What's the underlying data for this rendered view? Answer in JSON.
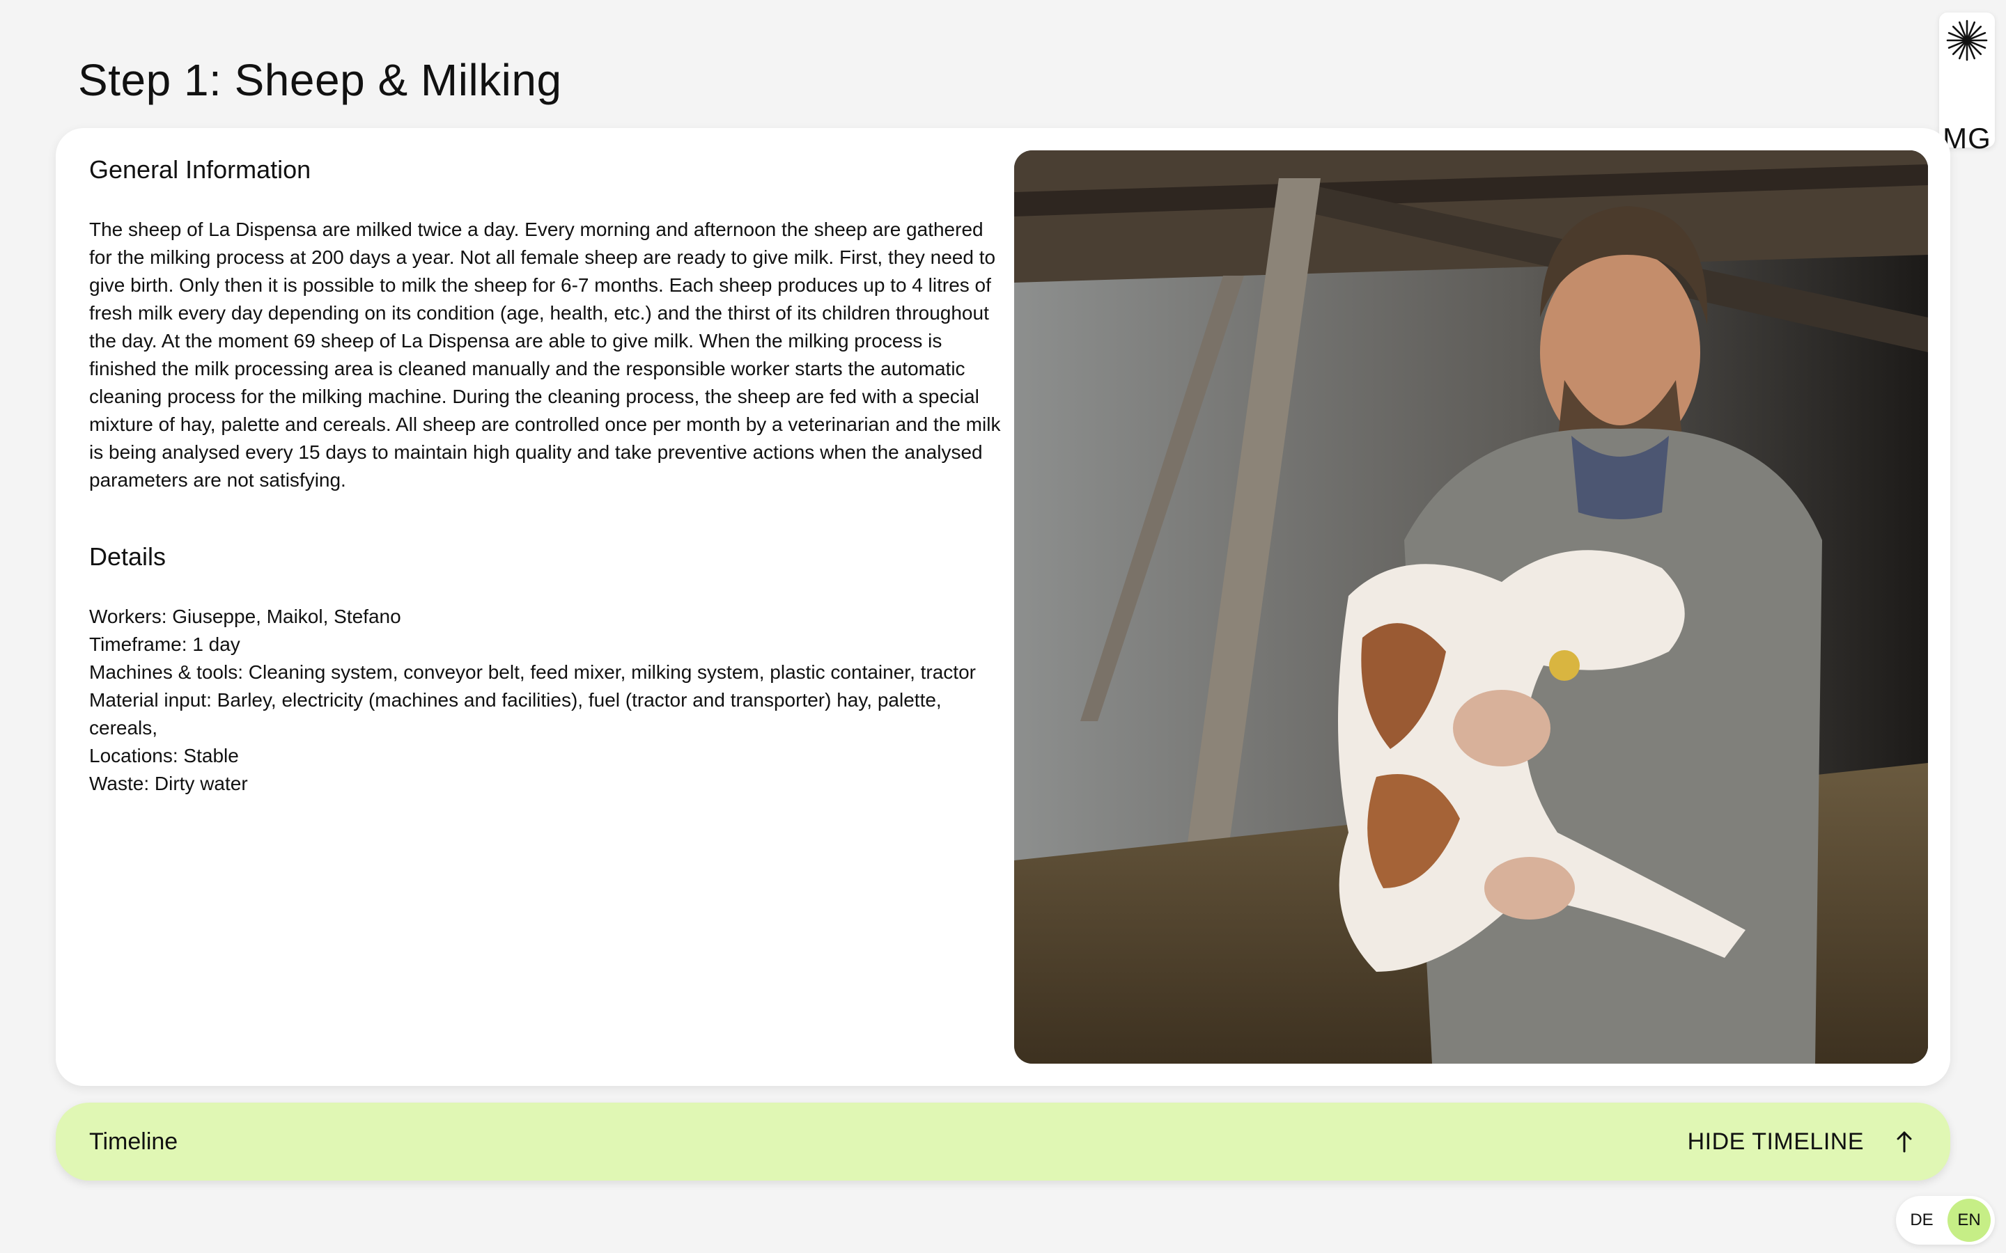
{
  "page": {
    "title": "Step 1: Sheep & Milking"
  },
  "side_tab": {
    "logo_icon": "starburst-logo-icon",
    "initials": "MG"
  },
  "general": {
    "heading": "General Information",
    "body": "The sheep of La Dispensa are milked twice a day. Every morning and afternoon the sheep are gathered for the milking process at 200 days a year. Not all female sheep are ready to give milk. First, they need to give birth. Only then it is possible to milk the sheep for 6-7 months. Each sheep produces up to 4 litres of fresh milk every day depending on its condition (age, health, etc.) and the thirst of its children throughout the day. At the moment 69 sheep of La Dispensa are able to give milk. When the milking process is finished the milk processing area is cleaned manually and the responsible worker starts the automatic cleaning process for the milking machine. During the cleaning process, the sheep are fed with a special mixture of hay, palette and cereals. All sheep are controlled once per month by a veterinarian and the milk is being analysed every 15 days to maintain high quality and take preventive actions when the analysed parameters are not satisfying."
  },
  "details": {
    "heading": "Details",
    "workers": "Workers: Giuseppe, Maikol, Stefano",
    "timeframe": "Timeframe: 1 day",
    "machines": "Machines & tools: Cleaning system, conveyor belt, feed mixer, milking system, plastic container, tractor",
    "material": "Material input: Barley, electricity (machines and facilities), fuel (tractor and transporter) hay, palette, cereals,",
    "locations": "Locations: Stable",
    "waste": "Waste: Dirty water"
  },
  "timeline": {
    "label": "Timeline",
    "toggle_label": "HIDE TIMELINE",
    "toggle_icon": "arrow-up-icon"
  },
  "language": {
    "options": [
      "DE",
      "EN"
    ],
    "selected": "EN",
    "active_color": "#c6ee86"
  },
  "colors": {
    "background": "#f4f4f4",
    "timeline_bar": "#e0f7b4"
  }
}
